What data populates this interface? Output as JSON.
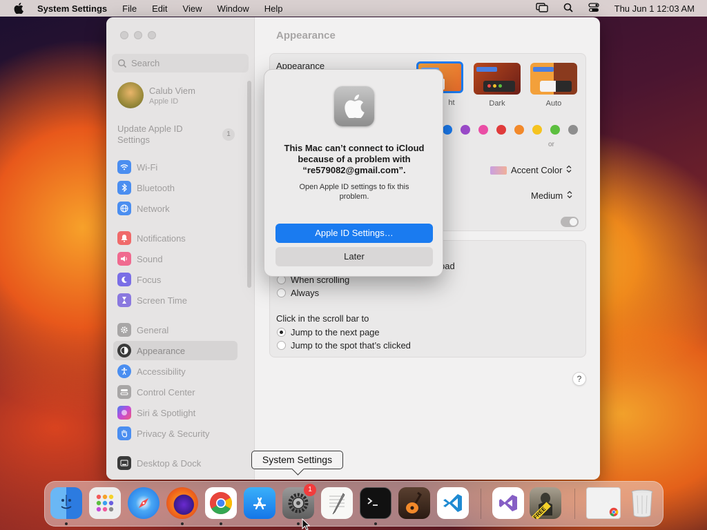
{
  "menubar": {
    "app_name": "System Settings",
    "menus": [
      "File",
      "Edit",
      "View",
      "Window",
      "Help"
    ],
    "clock": "Thu Jun 1  12:03 AM"
  },
  "sidebar": {
    "search_placeholder": "Search",
    "user": {
      "name": "Calub Viem",
      "subtitle": "Apple ID"
    },
    "update": {
      "label": "Update Apple ID Settings",
      "badge": "1"
    },
    "items": [
      {
        "label": "Wi-Fi",
        "icon": "wifi-icon",
        "color": "#3b8bf5"
      },
      {
        "label": "Bluetooth",
        "icon": "bluetooth-icon",
        "color": "#3b8bf5"
      },
      {
        "label": "Network",
        "icon": "globe-icon",
        "color": "#3b8bf5"
      },
      {
        "label": "Notifications",
        "icon": "bell-icon",
        "color": "#f25a5a"
      },
      {
        "label": "Sound",
        "icon": "speaker-icon",
        "color": "#f25a8a"
      },
      {
        "label": "Focus",
        "icon": "moon-icon",
        "color": "#6a5fe0"
      },
      {
        "label": "Screen Time",
        "icon": "hourglass-icon",
        "color": "#7a68d6"
      },
      {
        "label": "General",
        "icon": "gear-icon",
        "color": "#9a9898"
      },
      {
        "label": "Appearance",
        "icon": "appearance-icon",
        "color": "#222222"
      },
      {
        "label": "Accessibility",
        "icon": "accessibility-icon",
        "color": "#3b8bf5"
      },
      {
        "label": "Control Center",
        "icon": "control-center-icon",
        "color": "#9a9898"
      },
      {
        "label": "Siri & Spotlight",
        "icon": "siri-icon",
        "color": "#b45bd8"
      },
      {
        "label": "Privacy & Security",
        "icon": "hand-icon",
        "color": "#3b8bf5"
      },
      {
        "label": "Desktop & Dock",
        "icon": "dock-icon",
        "color": "#333333"
      }
    ],
    "selected": "Appearance"
  },
  "main": {
    "title": "Appearance",
    "appearance_label": "Appearance",
    "modes": [
      "ht",
      "Dark",
      "Auto"
    ],
    "accent_colors": [
      "#1a7bf0",
      "#9a4ac9",
      "#ea4ea5",
      "#e03b3b",
      "#f2892a",
      "#f5c31f",
      "#5cbf3f",
      "#8e8e8e"
    ],
    "accent_partial_label": "or",
    "highlight_value": "Accent Color",
    "sidebar_icon_size_value": "Medium",
    "scroll_partial_label": "ckpad",
    "show_scrollbars_options": [
      "When scrolling",
      "Always"
    ],
    "click_scroll_label": "Click in the scroll bar to",
    "click_scroll_options": [
      "Jump to the next page",
      "Jump to the spot that’s clicked"
    ],
    "help": "?"
  },
  "dialog": {
    "title": "This Mac can’t connect to iCloud because of a problem with “re579082@gmail.com”.",
    "message": "Open Apple ID settings to fix this problem.",
    "primary": "Apple ID Settings…",
    "secondary": "Later"
  },
  "tooltip": "System Settings",
  "dock": {
    "apps": [
      "Finder",
      "Launchpad",
      "Safari",
      "Firefox",
      "Chrome",
      "App Store",
      "System Settings",
      "TextEdit",
      "Terminal",
      "GarageBand",
      "Visual Studio Code",
      "Visual Studio",
      "Thinker",
      "Chrome Window",
      "Trash"
    ],
    "badge": "1",
    "thinker_label": "FREE"
  }
}
